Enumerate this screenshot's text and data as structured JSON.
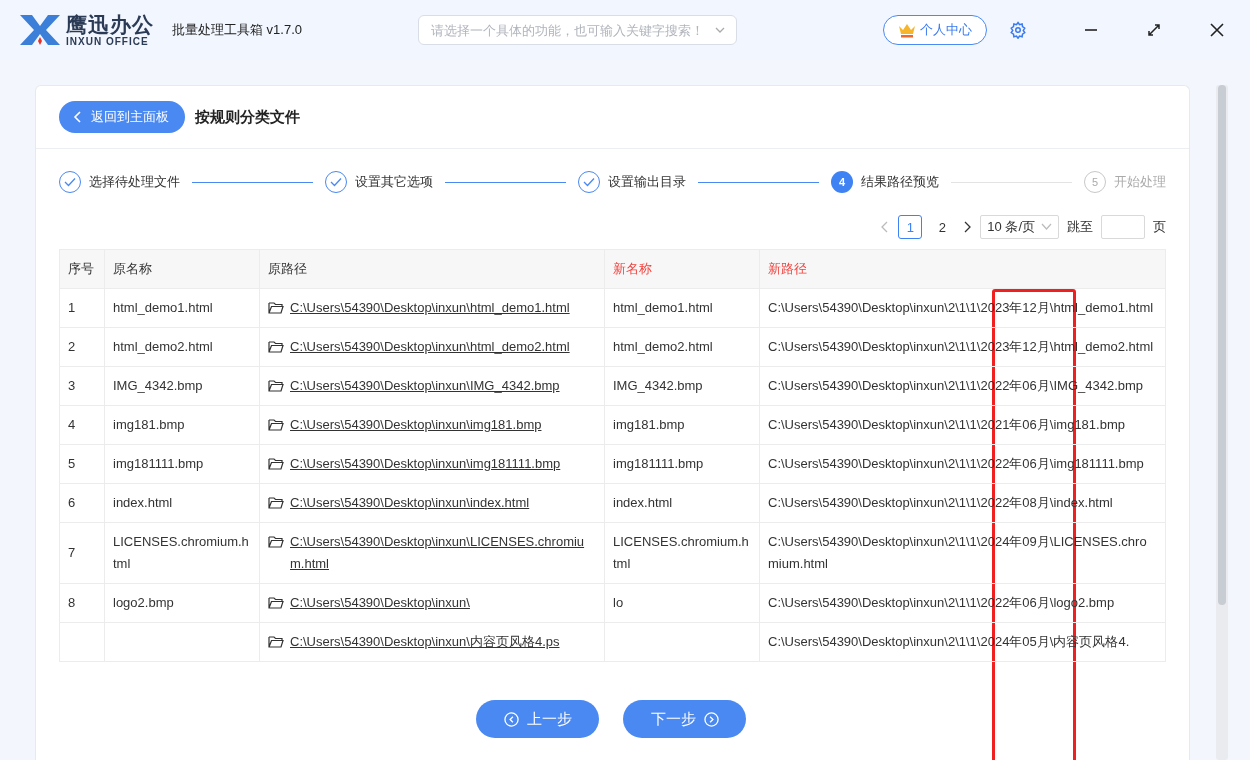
{
  "app": {
    "logo_name": "鹰迅办公",
    "logo_sub": "INXUN OFFICE",
    "title": "批量处理工具箱 v1.7.0"
  },
  "search": {
    "placeholder": "请选择一个具体的功能，也可输入关键字搜索！"
  },
  "user_button": "个人中心",
  "back_button": "返回到主面板",
  "page_title": "按规则分类文件",
  "steps": [
    {
      "label": "选择待处理文件",
      "kind": "done"
    },
    {
      "label": "设置其它选项",
      "kind": "done"
    },
    {
      "label": "设置输出目录",
      "kind": "done"
    },
    {
      "number": "4",
      "label": "结果路径预览",
      "kind": "active"
    },
    {
      "number": "5",
      "label": "开始处理",
      "kind": "pending"
    }
  ],
  "pagination": {
    "pages": [
      {
        "label": "1",
        "selected": true
      },
      {
        "label": "2",
        "selected": false
      }
    ],
    "page_size": "10 条/页",
    "jump_label": "跳至",
    "page_unit": "页"
  },
  "table": {
    "columns": [
      {
        "label": "序号",
        "highlight": false
      },
      {
        "label": "原名称",
        "highlight": false
      },
      {
        "label": "原路径",
        "highlight": false
      },
      {
        "label": "新名称",
        "highlight": true
      },
      {
        "label": "新路径",
        "highlight": true
      }
    ],
    "rows": [
      {
        "index": "1",
        "name": "html_demo1.html",
        "path": "C:\\Users\\54390\\Desktop\\inxun\\html_demo1.html",
        "new_name": "html_demo1.html",
        "new_path": "C:\\Users\\54390\\Desktop\\inxun\\2\\1\\1\\2023年12月\\html_demo1.html"
      },
      {
        "index": "2",
        "name": "html_demo2.html",
        "path": "C:\\Users\\54390\\Desktop\\inxun\\html_demo2.html",
        "new_name": "html_demo2.html",
        "new_path": "C:\\Users\\54390\\Desktop\\inxun\\2\\1\\1\\2023年12月\\html_demo2.html"
      },
      {
        "index": "3",
        "name": "IMG_4342.bmp",
        "path": "C:\\Users\\54390\\Desktop\\inxun\\IMG_4342.bmp",
        "new_name": "IMG_4342.bmp",
        "new_path": "C:\\Users\\54390\\Desktop\\inxun\\2\\1\\1\\2022年06月\\IMG_4342.bmp"
      },
      {
        "index": "4",
        "name": "img181.bmp",
        "path": "C:\\Users\\54390\\Desktop\\inxun\\img181.bmp",
        "new_name": "img181.bmp",
        "new_path": "C:\\Users\\54390\\Desktop\\inxun\\2\\1\\1\\2021年06月\\img181.bmp"
      },
      {
        "index": "5",
        "name": "img181111.bmp",
        "path": "C:\\Users\\54390\\Desktop\\inxun\\img181111.bmp",
        "new_name": "img181111.bmp",
        "new_path": "C:\\Users\\54390\\Desktop\\inxun\\2\\1\\1\\2022年06月\\img181111.bmp"
      },
      {
        "index": "6",
        "name": "index.html",
        "path": "C:\\Users\\54390\\Desktop\\inxun\\index.html",
        "new_name": "index.html",
        "new_path": "C:\\Users\\54390\\Desktop\\inxun\\2\\1\\1\\2022年08月\\index.html"
      },
      {
        "index": "7",
        "name": "LICENSES.chromium.html",
        "path": "C:\\Users\\54390\\Desktop\\inxun\\LICENSES.chromium.html",
        "new_name": "LICENSES.chromium.html",
        "new_path": "C:\\Users\\54390\\Desktop\\inxun\\2\\1\\1\\2024年09月\\LICENSES.chromium.html"
      },
      {
        "index": "8",
        "name": "logo2.bmp",
        "path": "C:\\Users\\54390\\Desktop\\inxun\\",
        "new_name": "lo",
        "new_path": "C:\\Users\\54390\\Desktop\\inxun\\2\\1\\1\\2022年06月\\logo2.bmp"
      },
      {
        "path": "C:\\Users\\54390\\Desktop\\inxun\\内容页风格4.ps",
        "new_path": "C:\\Users\\54390\\Desktop\\inxun\\2\\1\\1\\2024年05月\\内容页风格4."
      }
    ]
  },
  "prev_button": "上一步",
  "next_button": "下一步"
}
